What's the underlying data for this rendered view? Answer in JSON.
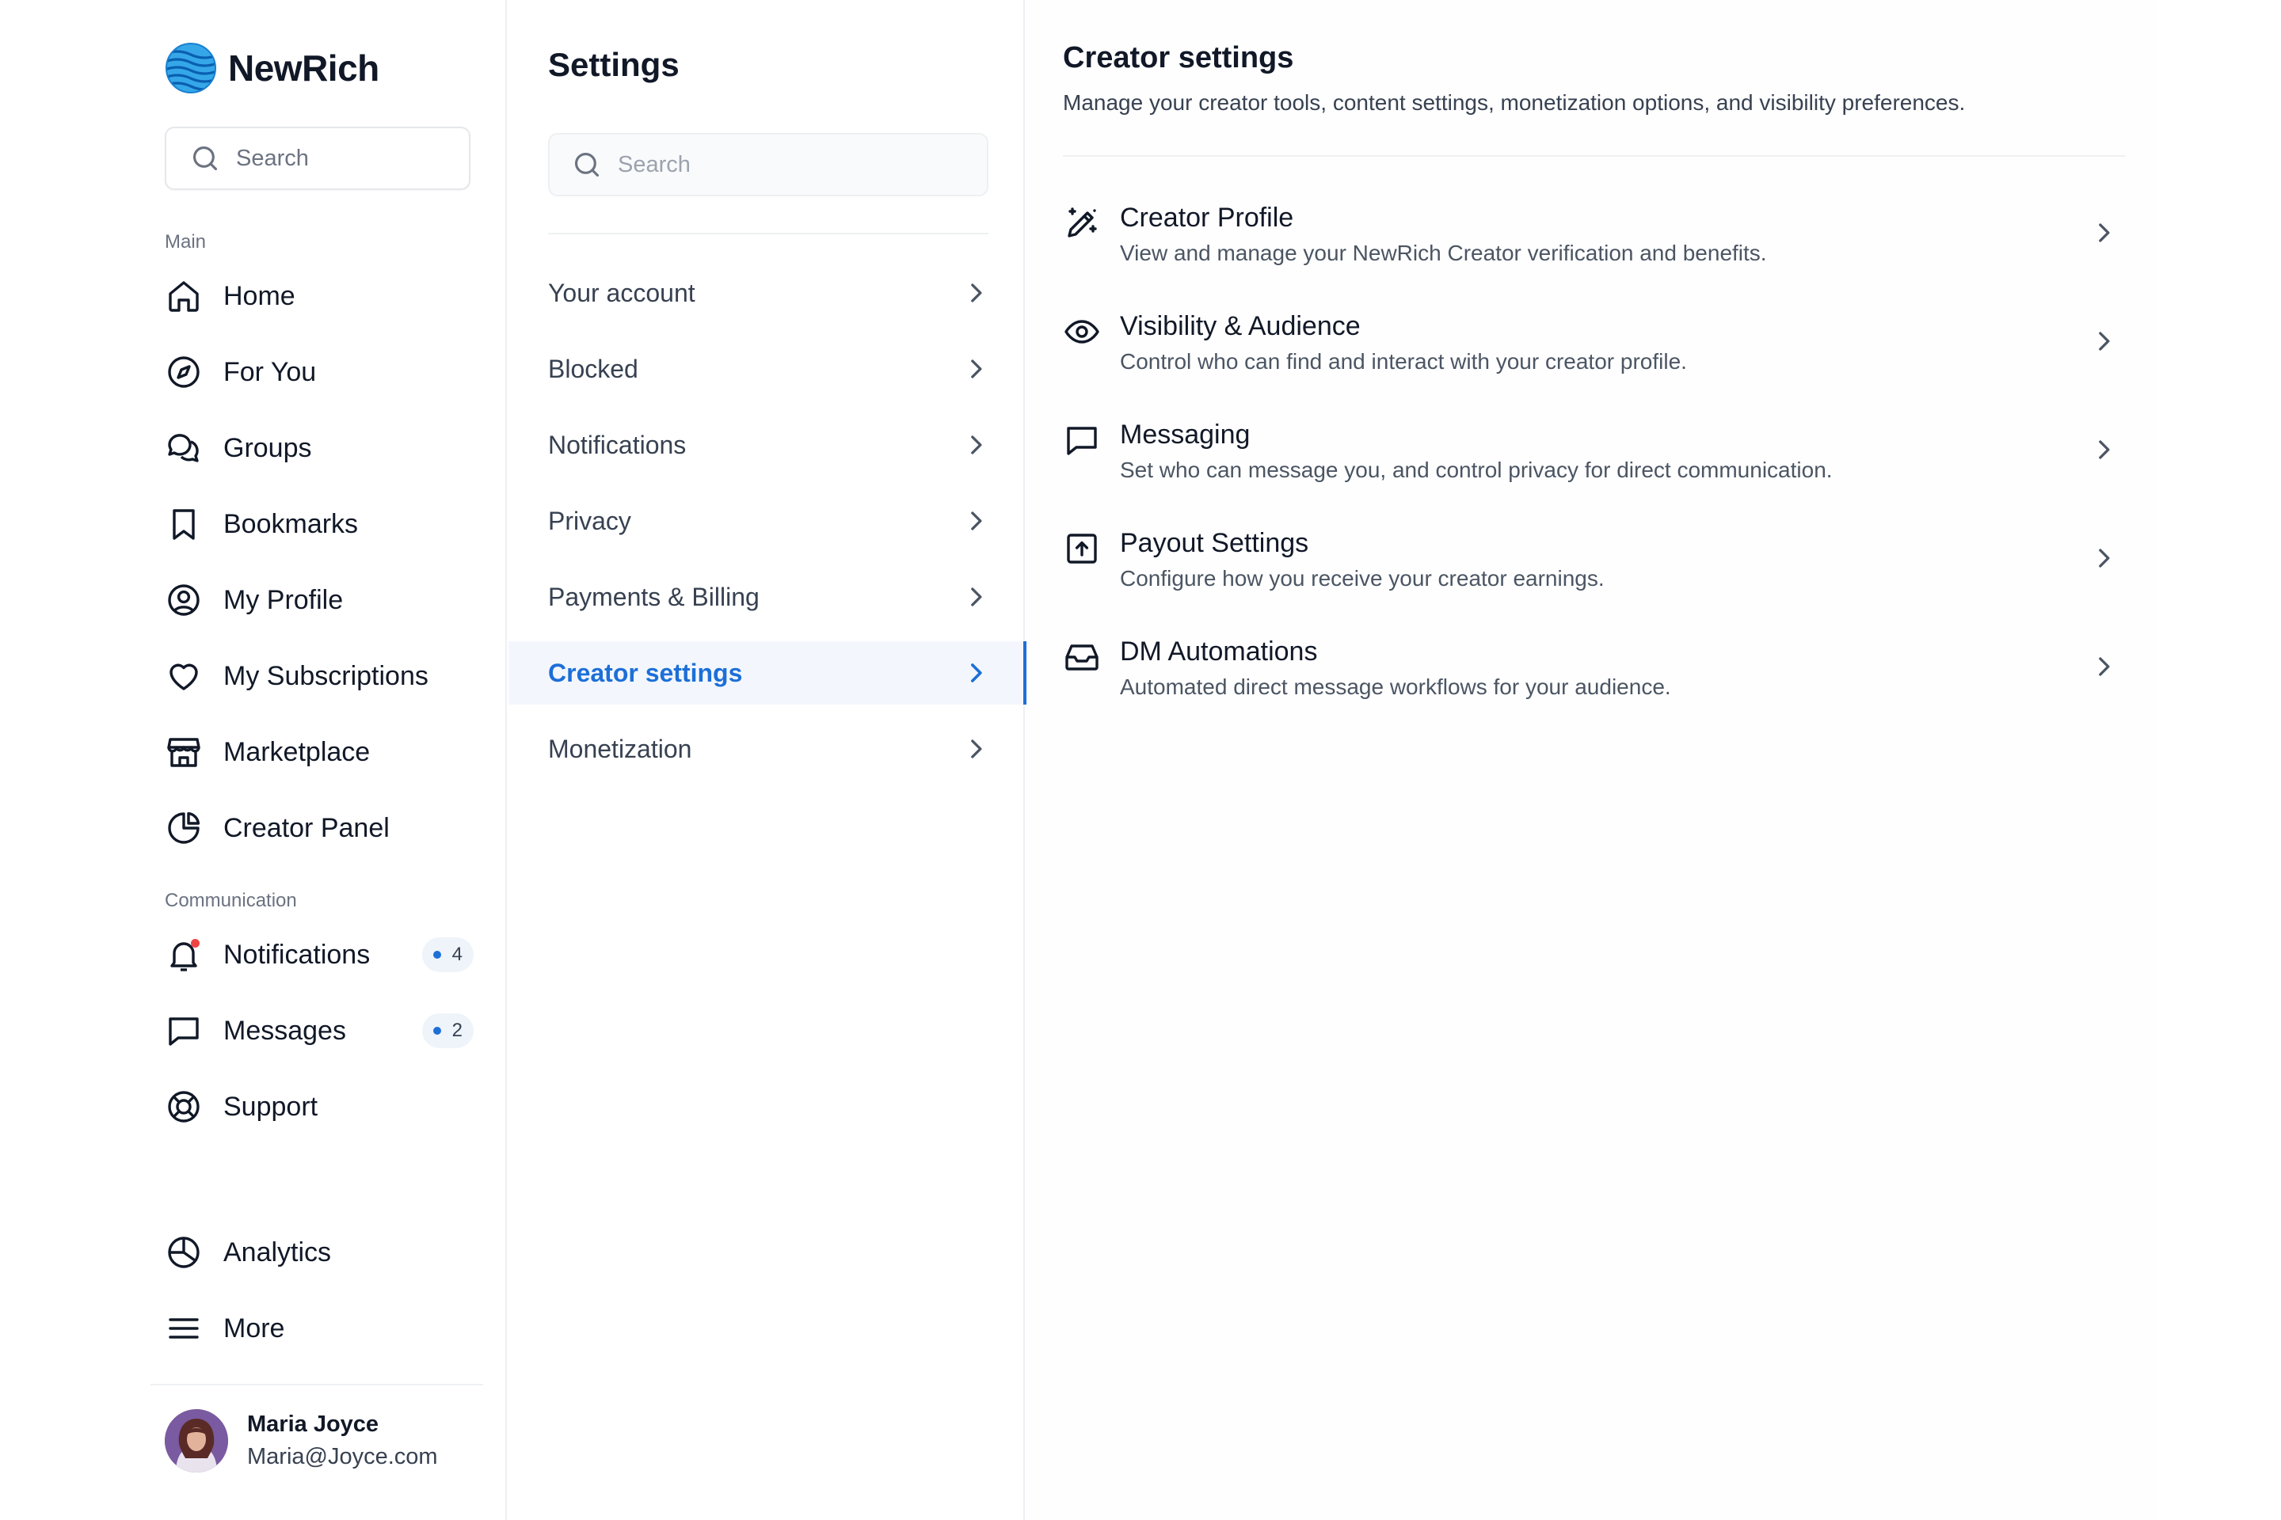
{
  "brand": {
    "name": "NewRich"
  },
  "sidebar": {
    "search_placeholder": "Search",
    "main_label": "Main",
    "main_items": [
      {
        "label": "Home",
        "icon": "home-icon"
      },
      {
        "label": "For You",
        "icon": "compass-icon"
      },
      {
        "label": "Groups",
        "icon": "chat-bubbles-icon"
      },
      {
        "label": "Bookmarks",
        "icon": "bookmark-icon"
      },
      {
        "label": "My Profile",
        "icon": "user-circle-icon"
      },
      {
        "label": "My Subscriptions",
        "icon": "heart-icon"
      },
      {
        "label": "Marketplace",
        "icon": "store-icon"
      },
      {
        "label": "Creator Panel",
        "icon": "pie-chart-icon"
      }
    ],
    "communication_label": "Communication",
    "communication_items": [
      {
        "label": "Notifications",
        "icon": "bell-icon",
        "badge": "4"
      },
      {
        "label": "Messages",
        "icon": "message-square-icon",
        "badge": "2"
      },
      {
        "label": "Support",
        "icon": "lifebuoy-icon"
      }
    ],
    "bottom_items": [
      {
        "label": "Analytics",
        "icon": "analytics-icon"
      },
      {
        "label": "More",
        "icon": "menu-icon"
      }
    ],
    "user": {
      "name": "Maria Joyce",
      "email": "Maria@Joyce.com"
    }
  },
  "settings": {
    "title": "Settings",
    "search_placeholder": "Search",
    "items": [
      {
        "label": "Your account"
      },
      {
        "label": "Blocked"
      },
      {
        "label": "Notifications"
      },
      {
        "label": "Privacy"
      },
      {
        "label": "Payments & Billing"
      },
      {
        "label": "Creator settings",
        "active": true
      },
      {
        "label": "Monetization"
      }
    ]
  },
  "content": {
    "title": "Creator settings",
    "description": "Manage your creator tools, content settings, monetization options, and visibility preferences.",
    "rows": [
      {
        "title": "Creator Profile",
        "description": "View and manage your NewRich Creator verification and benefits.",
        "icon": "magic-pen-icon"
      },
      {
        "title": "Visibility & Audience",
        "description": "Control who can find and interact with your creator profile.",
        "icon": "eye-icon"
      },
      {
        "title": "Messaging",
        "description": "Set who can message you, and control privacy for direct communication.",
        "icon": "message-square-icon"
      },
      {
        "title": "Payout Settings",
        "description": "Configure how you receive your creator earnings.",
        "icon": "upload-box-icon"
      },
      {
        "title": "DM Automations",
        "description": "Automated direct message workflows for your audience.",
        "icon": "inbox-icon"
      }
    ]
  },
  "colors": {
    "accent": "#1d6fd8",
    "alert": "#ef4444",
    "text": "#111827",
    "muted": "#4b5563"
  }
}
